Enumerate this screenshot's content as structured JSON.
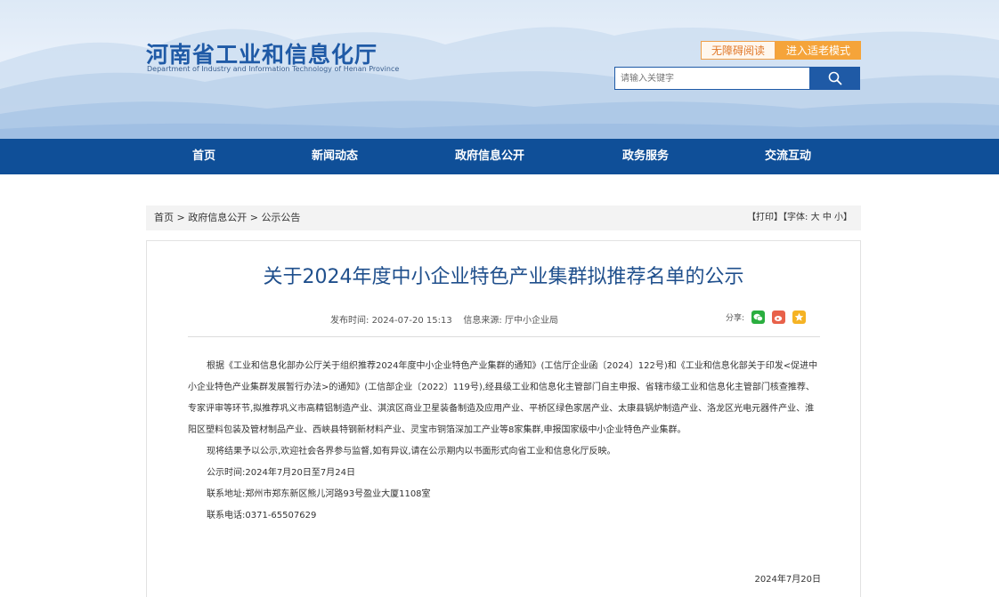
{
  "header": {
    "title": "河南省工业和信息化厅",
    "subtitle": "Department of Industry and Information Technology of Henan Province",
    "accessibility_label": "无障碍阅读",
    "elder_mode_label": "进入适老模式",
    "search_placeholder": "请输入关键字",
    "colors": {
      "brand": "#1f5aa6",
      "accent": "#f5a43a"
    }
  },
  "nav": {
    "items": [
      "首页",
      "新闻动态",
      "政府信息公开",
      "政务服务",
      "交流互动"
    ]
  },
  "breadcrumb": {
    "items": [
      "首页",
      "政府信息公开",
      "公示公告"
    ],
    "separator": " > ",
    "print_label": "【打印】",
    "font_label": "【字体:",
    "font_large": "大",
    "font_medium": "中",
    "font_small": "小",
    "font_close": "】"
  },
  "article": {
    "title": "关于2024年度中小企业特色产业集群拟推荐名单的公示",
    "publish_time_label": "发布时间:",
    "publish_time": "2024-07-20 15:13",
    "source_label": "信息来源:",
    "source": "厅中小企业局",
    "share_label": "分享:",
    "share_icons": [
      "wechat-icon",
      "weibo-icon",
      "qzone-icon"
    ],
    "paragraphs": [
      "根据《工业和信息化部办公厅关于组织推荐2024年度中小企业特色产业集群的通知》(工信厅企业函〔2024〕122号)和《工业和信息化部关于印发<促进中小企业特色产业集群发展暂行办法>的通知》(工信部企业〔2022〕119号),经县级工业和信息化主管部门自主申报、省辖市级工业和信息化主管部门核查推荐、专家评审等环节,拟推荐巩义市高精铝制造产业、淇滨区商业卫星装备制造及应用产业、平桥区绿色家居产业、太康县锅炉制造产业、洛龙区光电元器件产业、淮阳区塑料包装及管材制品产业、西峡县特钢新材料产业、灵宝市铜箔深加工产业等8家集群,申报国家级中小企业特色产业集群。",
      "现将结果予以公示,欢迎社会各界参与监督,如有异议,请在公示期内以书面形式向省工业和信息化厅反映。",
      "公示时间:2024年7月20日至7月24日",
      "联系地址:郑州市郑东新区熊儿河路93号盈业大厦1108室",
      "联系电话:0371-65507629"
    ],
    "sign_date": "2024年7月20日"
  }
}
